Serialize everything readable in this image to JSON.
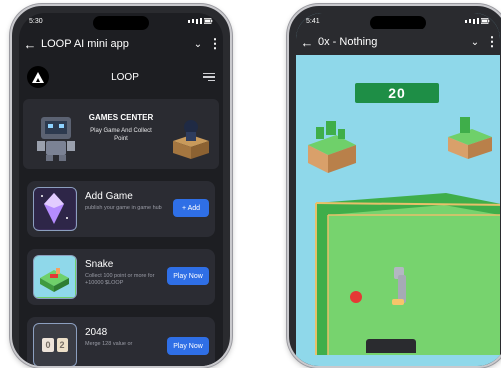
{
  "left_phone": {
    "status": {
      "time": "5:30"
    },
    "app_bar": {
      "title": "LOOP AI mini app"
    },
    "brand": "LOOP",
    "games_center": {
      "title": "GAMES CENTER",
      "subtitle": "Play Game And Collect Point"
    },
    "cards": [
      {
        "title": "Add Game",
        "description": "publish your game in game hub",
        "button": "+ Add"
      },
      {
        "title": "Snake",
        "description": "Collect 100 point or more for +10000 $LOOP",
        "button": "Play Now"
      },
      {
        "title": "2048",
        "description": "Merge 128 value or",
        "button": "Play Now",
        "icon_tiles": [
          "0",
          "2"
        ]
      }
    ]
  },
  "right_phone": {
    "status": {
      "time": "5:41"
    },
    "app_bar": {
      "title": "0x - Nothing"
    },
    "score": "20"
  },
  "colors": {
    "dark_bg": "#1d1e22",
    "card_bg": "#2b2c33",
    "button_blue": "#2f6fe6",
    "sky": "#8fd8ea",
    "grass": "#6fd06a",
    "score_green": "#1e8e46"
  }
}
